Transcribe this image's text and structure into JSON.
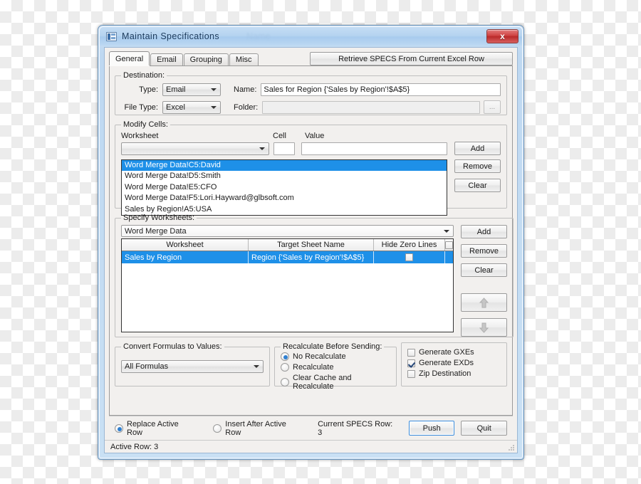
{
  "window": {
    "title": "Maintain  Specifications",
    "ghost_text": "Name",
    "close_label": "x",
    "icon": "spreadsheet-icon"
  },
  "tabs": [
    {
      "label": "General",
      "active": true
    },
    {
      "label": "Email",
      "active": false
    },
    {
      "label": "Grouping",
      "active": false
    },
    {
      "label": "Misc",
      "active": false
    }
  ],
  "retrieve_button": "Retrieve SPECS From Current Excel Row",
  "destination": {
    "legend": "Destination:",
    "type_label": "Type:",
    "type_value": "Email",
    "name_label": "Name:",
    "name_value": "Sales for Region {'Sales by Region'!$A$5}",
    "filetype_label": "File Type:",
    "filetype_value": "Excel",
    "folder_label": "Folder:",
    "folder_value": "",
    "browse_label": "..."
  },
  "modify_cells": {
    "legend": "Modify Cells:",
    "worksheet_label": "Worksheet",
    "cell_label": "Cell",
    "value_label": "Value",
    "worksheet_value": "",
    "cell_value": "",
    "value_value": "",
    "add_label": "Add",
    "remove_label": "Remove",
    "clear_label": "Clear",
    "items": [
      {
        "text": "Word Merge Data!C5:David",
        "selected": true
      },
      {
        "text": "Word Merge Data!D5:Smith",
        "selected": false
      },
      {
        "text": "Word Merge Data!E5:CFO",
        "selected": false
      },
      {
        "text": "Word Merge Data!F5:Lori.Hayward@glbsoft.com",
        "selected": false
      },
      {
        "text": "Sales by Region!A5:USA",
        "selected": false
      }
    ]
  },
  "specify_worksheets": {
    "legend": "Specify Worksheets:",
    "combo_value": "Word Merge Data",
    "add_label": "Add",
    "remove_label": "Remove",
    "clear_label": "Clear",
    "move_up_icon": "arrow-up-icon",
    "move_down_icon": "arrow-down-icon",
    "columns": [
      "Worksheet",
      "Target Sheet Name",
      "Hide Zero Lines",
      ""
    ],
    "rows": [
      {
        "worksheet": "Sales by Region",
        "target_sheet_name": "Region {'Sales by Region'!$A$5}",
        "hide_zero_lines": false,
        "selected": true
      }
    ]
  },
  "convert_formulas": {
    "legend": "Convert Formulas to Values:",
    "value": "All Formulas"
  },
  "recalculate": {
    "legend": "Recalculate Before Sending:",
    "options": [
      {
        "label": "No Recalculate",
        "checked": true
      },
      {
        "label": "Recalculate",
        "checked": false
      },
      {
        "label": "Clear Cache and Recalculate",
        "checked": false
      }
    ]
  },
  "output_options": [
    {
      "label": "Generate GXEs",
      "checked": false
    },
    {
      "label": "Generate EXDs",
      "checked": true
    },
    {
      "label": "Zip Destination",
      "checked": false
    }
  ],
  "bottom": {
    "row_mode": [
      {
        "label": "Replace Active Row",
        "checked": true
      },
      {
        "label": "Insert After Active Row",
        "checked": false
      }
    ],
    "current_specs_row": "Current SPECS Row: 3",
    "push_label": "Push",
    "quit_label": "Quit"
  },
  "statusbar": {
    "text": "Active Row: 3"
  },
  "colors": {
    "selection": "#1e90e8",
    "titlebar": "#a8cbee",
    "close_button": "#cf4242",
    "focus_border": "#3c8ddc"
  }
}
